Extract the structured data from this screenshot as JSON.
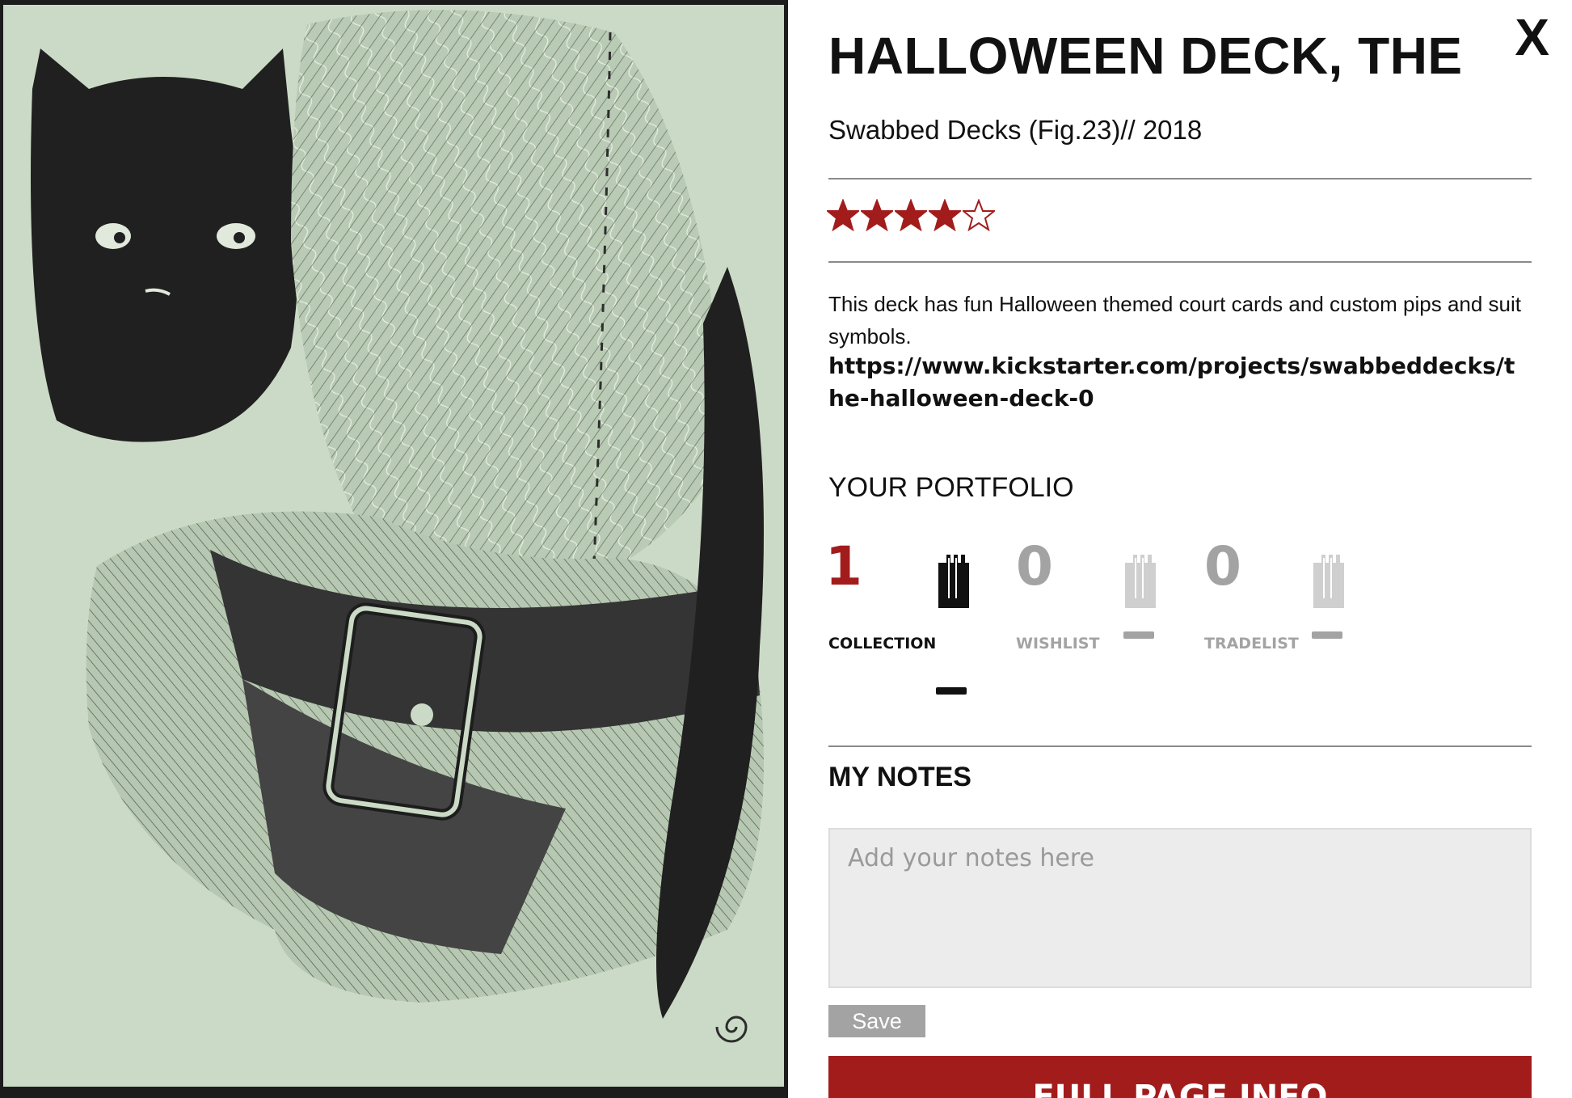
{
  "deck": {
    "title": "HALLOWEEN DECK, THE",
    "subtitle": "Swabbed Decks (Fig.23)// 2018",
    "rating": 4,
    "rating_max": 5,
    "description": "This deck has fun Halloween themed court cards and custom pips and suit symbols.",
    "link": "https://www.kickstarter.com/projects/swabbeddecks/the-halloween-deck-0"
  },
  "close_label": "X",
  "portfolio": {
    "heading": "YOUR PORTFOLIO",
    "collection": {
      "count": "1",
      "label": "COLLECTION"
    },
    "wishlist": {
      "count": "0",
      "label": "WISHLIST"
    },
    "tradelist": {
      "count": "0",
      "label": "TRADELIST"
    }
  },
  "notes": {
    "heading": "MY NOTES",
    "placeholder": "Add your notes here",
    "save_label": "Save"
  },
  "full_page_label": "FULL PAGE INFO",
  "colors": {
    "accent_red": "#a31c1c",
    "inactive_gray": "#a3a3a3",
    "deck_green": "#c8d8c2"
  },
  "icons": {
    "star_filled": "star-filled-icon",
    "star_empty": "star-outline-icon",
    "deck": "deck-stack-icon",
    "minus": "minus-icon"
  }
}
